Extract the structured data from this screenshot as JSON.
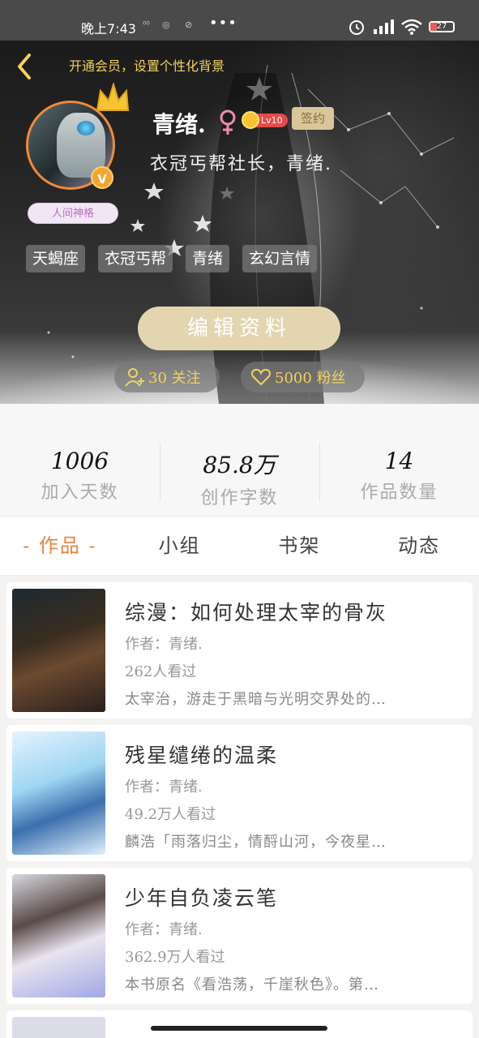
{
  "status_bar": {
    "time": "晚上7:43",
    "battery": "27"
  },
  "header": {
    "vip_banner": "开通会员，设置个性化背景"
  },
  "profile": {
    "name": "青绪.",
    "level": "Lv10",
    "sign_badge": "签约",
    "title_badge": "人间神格",
    "bio": "衣冠丐帮社长，青绪.",
    "tags": [
      "天蝎座",
      "衣冠丐帮",
      "青绪",
      "玄幻言情"
    ],
    "edit_button": "编辑资料",
    "following": "30 关注",
    "fans": "5000 粉丝"
  },
  "stats": [
    {
      "value": "1006",
      "label": "加入天数"
    },
    {
      "value": "85.8万",
      "label": "创作字数"
    },
    {
      "value": "14",
      "label": "作品数量"
    }
  ],
  "tabs": [
    "- 作品 -",
    "小组",
    "书架",
    "动态"
  ],
  "books": [
    {
      "title": "综漫：如何处理太宰的骨灰",
      "author": "作者：青绪.",
      "views": "262人看过",
      "desc": "太宰治，游走于黑暗与光明交界处的…"
    },
    {
      "title": "残星缱绻的温柔",
      "author": "作者：青绪.",
      "views": "49.2万人看过",
      "desc": "麟浩「雨落归尘，情酹山河，今夜星…"
    },
    {
      "title": "少年自负凌云笔",
      "author": "作者：青绪.",
      "views": "362.9万人看过",
      "desc": "本书原名《看浩荡，千崖秋色》。第…"
    }
  ],
  "colors": {
    "accent_orange": "#e7853f",
    "gold": "#f3d35a",
    "button_beige": "#e2d5b0"
  }
}
